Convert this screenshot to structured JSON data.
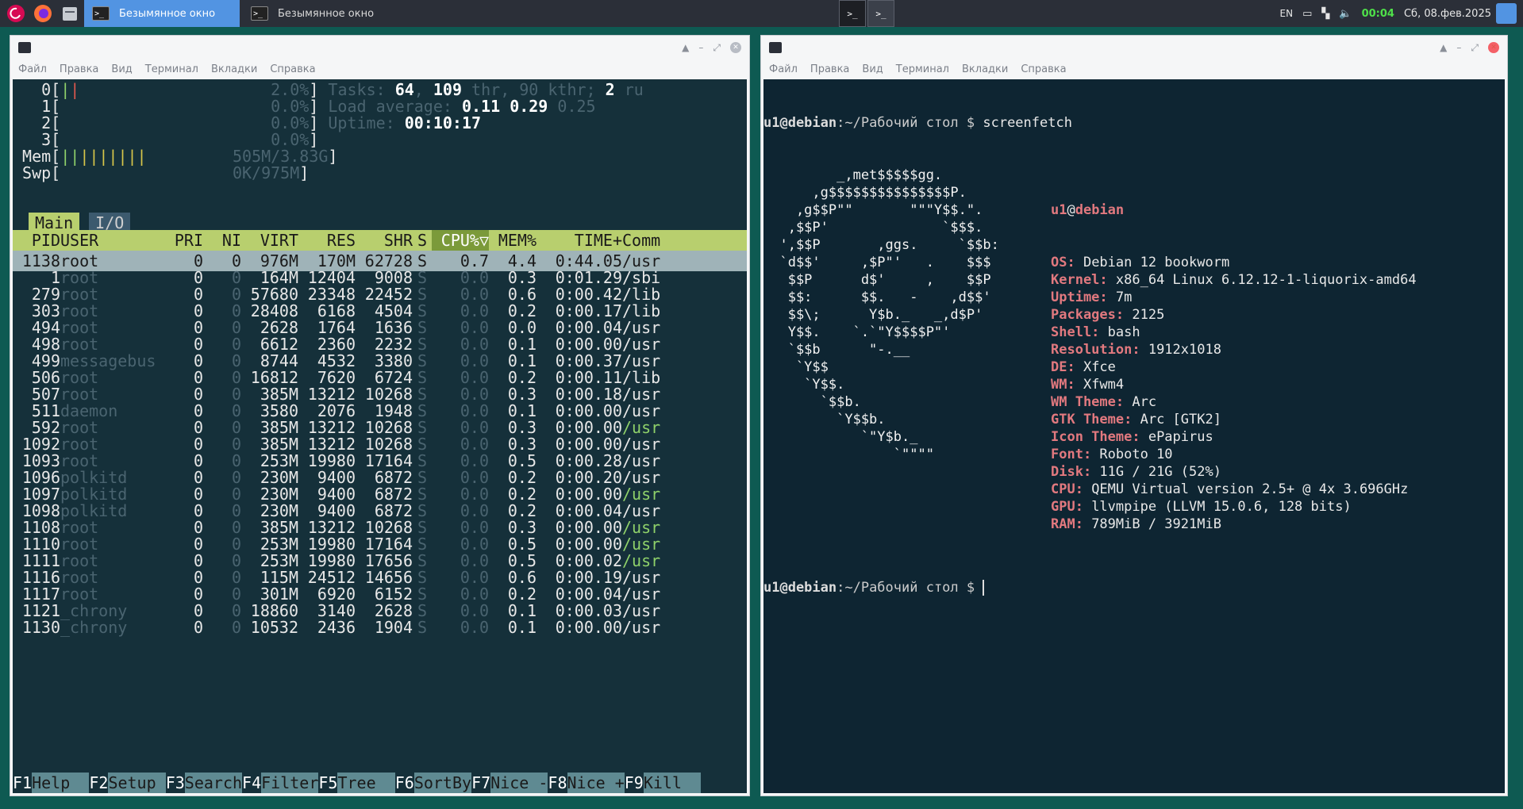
{
  "taskbar": {
    "active_task": "Безымянное окно",
    "inactive_task": "Безымянное окно",
    "lang": "EN",
    "time": "00:04",
    "date": "Сб, 08.фев.2025"
  },
  "left": {
    "menu": [
      "Файл",
      "Правка",
      "Вид",
      "Терминал",
      "Вкладки",
      "Справка"
    ],
    "cpus": [
      {
        "id": "0",
        "pct": "2.0%"
      },
      {
        "id": "1",
        "pct": "0.0%"
      },
      {
        "id": "2",
        "pct": "0.0%"
      },
      {
        "id": "3",
        "pct": "0.0%"
      }
    ],
    "mem": {
      "label": "Mem",
      "value": "505M/3.83G"
    },
    "swp": {
      "label": "Swp",
      "value": "0K/975M"
    },
    "tasks_line": {
      "label": "Tasks: ",
      "a": "64",
      "sep": ", ",
      "b": "109",
      "thr": " thr",
      "c": ", 90 kthr; ",
      "d": "2",
      "ru": " ru"
    },
    "load_line": {
      "label": "Load average: ",
      "a": "0.11",
      "b": "0.29",
      "c": "0.25"
    },
    "uptime_line": {
      "label": "Uptime: ",
      "value": "00:10:17"
    },
    "tabs": {
      "main": "Main",
      "io": "I/O"
    },
    "columns": {
      "pid": "PID",
      "user": "USER",
      "pri": "PRI",
      "ni": "NI",
      "virt": "VIRT",
      "res": "RES",
      "shr": "SHR",
      "s": "S",
      "cpu": "CPU%▽",
      "mem": "MEM%",
      "time": "TIME+",
      "cmd": "Comm"
    },
    "rows": [
      {
        "pid": "1138",
        "user": "root",
        "pri": "0",
        "ni": "0",
        "virt": "976M",
        "res": "170M",
        "shr": "62728",
        "s": "S",
        "cpu": "0.7",
        "mem": "4.4",
        "time": "0:44.05",
        "cmd": "/usr"
      },
      {
        "pid": "1",
        "user": "root",
        "pri": "0",
        "ni": "0",
        "virt": "164M",
        "res": "12404",
        "shr": "9008",
        "s": "S",
        "cpu": "0.0",
        "mem": "0.3",
        "time": "0:01.29",
        "cmd": "/sbi"
      },
      {
        "pid": "279",
        "user": "root",
        "pri": "0",
        "ni": "0",
        "virt": "57680",
        "res": "23348",
        "shr": "22452",
        "s": "S",
        "cpu": "0.0",
        "mem": "0.6",
        "time": "0:00.42",
        "cmd": "/lib"
      },
      {
        "pid": "303",
        "user": "root",
        "pri": "0",
        "ni": "0",
        "virt": "28408",
        "res": "6168",
        "shr": "4504",
        "s": "S",
        "cpu": "0.0",
        "mem": "0.2",
        "time": "0:00.17",
        "cmd": "/lib"
      },
      {
        "pid": "494",
        "user": "root",
        "pri": "0",
        "ni": "0",
        "virt": "2628",
        "res": "1764",
        "shr": "1636",
        "s": "S",
        "cpu": "0.0",
        "mem": "0.0",
        "time": "0:00.04",
        "cmd": "/usr"
      },
      {
        "pid": "498",
        "user": "root",
        "pri": "0",
        "ni": "0",
        "virt": "6612",
        "res": "2360",
        "shr": "2232",
        "s": "S",
        "cpu": "0.0",
        "mem": "0.1",
        "time": "0:00.00",
        "cmd": "/usr"
      },
      {
        "pid": "499",
        "user": "messagebus",
        "pri": "0",
        "ni": "0",
        "virt": "8744",
        "res": "4532",
        "shr": "3380",
        "s": "S",
        "cpu": "0.0",
        "mem": "0.1",
        "time": "0:00.37",
        "cmd": "/usr"
      },
      {
        "pid": "506",
        "user": "root",
        "pri": "0",
        "ni": "0",
        "virt": "16812",
        "res": "7620",
        "shr": "6724",
        "s": "S",
        "cpu": "0.0",
        "mem": "0.2",
        "time": "0:00.11",
        "cmd": "/lib"
      },
      {
        "pid": "507",
        "user": "root",
        "pri": "0",
        "ni": "0",
        "virt": "385M",
        "res": "13212",
        "shr": "10268",
        "s": "S",
        "cpu": "0.0",
        "mem": "0.3",
        "time": "0:00.18",
        "cmd": "/usr"
      },
      {
        "pid": "511",
        "user": "daemon",
        "pri": "0",
        "ni": "0",
        "virt": "3580",
        "res": "2076",
        "shr": "1948",
        "s": "S",
        "cpu": "0.0",
        "mem": "0.1",
        "time": "0:00.00",
        "cmd": "/usr"
      },
      {
        "pid": "592",
        "user": "root",
        "pri": "0",
        "ni": "0",
        "virt": "385M",
        "res": "13212",
        "shr": "10268",
        "s": "S",
        "cpu": "0.0",
        "mem": "0.3",
        "time": "0:00.00",
        "cmd": "/usr"
      },
      {
        "pid": "1092",
        "user": "root",
        "pri": "0",
        "ni": "0",
        "virt": "385M",
        "res": "13212",
        "shr": "10268",
        "s": "S",
        "cpu": "0.0",
        "mem": "0.3",
        "time": "0:00.00",
        "cmd": "/usr"
      },
      {
        "pid": "1093",
        "user": "root",
        "pri": "0",
        "ni": "0",
        "virt": "253M",
        "res": "19980",
        "shr": "17164",
        "s": "S",
        "cpu": "0.0",
        "mem": "0.5",
        "time": "0:00.28",
        "cmd": "/usr"
      },
      {
        "pid": "1096",
        "user": "polkitd",
        "pri": "0",
        "ni": "0",
        "virt": "230M",
        "res": "9400",
        "shr": "6872",
        "s": "S",
        "cpu": "0.0",
        "mem": "0.2",
        "time": "0:00.20",
        "cmd": "/usr"
      },
      {
        "pid": "1097",
        "user": "polkitd",
        "pri": "0",
        "ni": "0",
        "virt": "230M",
        "res": "9400",
        "shr": "6872",
        "s": "S",
        "cpu": "0.0",
        "mem": "0.2",
        "time": "0:00.00",
        "cmd": "/usr"
      },
      {
        "pid": "1098",
        "user": "polkitd",
        "pri": "0",
        "ni": "0",
        "virt": "230M",
        "res": "9400",
        "shr": "6872",
        "s": "S",
        "cpu": "0.0",
        "mem": "0.2",
        "time": "0:00.04",
        "cmd": "/usr"
      },
      {
        "pid": "1108",
        "user": "root",
        "pri": "0",
        "ni": "0",
        "virt": "385M",
        "res": "13212",
        "shr": "10268",
        "s": "S",
        "cpu": "0.0",
        "mem": "0.3",
        "time": "0:00.00",
        "cmd": "/usr"
      },
      {
        "pid": "1110",
        "user": "root",
        "pri": "0",
        "ni": "0",
        "virt": "253M",
        "res": "19980",
        "shr": "17164",
        "s": "S",
        "cpu": "0.0",
        "mem": "0.5",
        "time": "0:00.00",
        "cmd": "/usr"
      },
      {
        "pid": "1111",
        "user": "root",
        "pri": "0",
        "ni": "0",
        "virt": "253M",
        "res": "19980",
        "shr": "17656",
        "s": "S",
        "cpu": "0.0",
        "mem": "0.5",
        "time": "0:00.02",
        "cmd": "/usr"
      },
      {
        "pid": "1116",
        "user": "root",
        "pri": "0",
        "ni": "0",
        "virt": "115M",
        "res": "24512",
        "shr": "14656",
        "s": "S",
        "cpu": "0.0",
        "mem": "0.6",
        "time": "0:00.19",
        "cmd": "/usr"
      },
      {
        "pid": "1117",
        "user": "root",
        "pri": "0",
        "ni": "0",
        "virt": "301M",
        "res": "6920",
        "shr": "6152",
        "s": "S",
        "cpu": "0.0",
        "mem": "0.2",
        "time": "0:00.04",
        "cmd": "/usr"
      },
      {
        "pid": "1121",
        "user": "_chrony",
        "pri": "0",
        "ni": "0",
        "virt": "18860",
        "res": "3140",
        "shr": "2628",
        "s": "S",
        "cpu": "0.0",
        "mem": "0.1",
        "time": "0:00.03",
        "cmd": "/usr"
      },
      {
        "pid": "1130",
        "user": "_chrony",
        "pri": "0",
        "ni": "0",
        "virt": "10532",
        "res": "2436",
        "shr": "1904",
        "s": "S",
        "cpu": "0.0",
        "mem": "0.1",
        "time": "0:00.00",
        "cmd": "/usr"
      }
    ],
    "fkeys": [
      {
        "k": "F1",
        "l": "Help  "
      },
      {
        "k": "F2",
        "l": "Setup "
      },
      {
        "k": "F3",
        "l": "Search"
      },
      {
        "k": "F4",
        "l": "Filter"
      },
      {
        "k": "F5",
        "l": "Tree  "
      },
      {
        "k": "F6",
        "l": "SortBy"
      },
      {
        "k": "F7",
        "l": "Nice -"
      },
      {
        "k": "F8",
        "l": "Nice +"
      },
      {
        "k": "F9",
        "l": "Kill  "
      }
    ]
  },
  "right": {
    "menu": [
      "Файл",
      "Правка",
      "Вид",
      "Терминал",
      "Вкладки",
      "Справка"
    ],
    "prompt_user": "u1@debian",
    "prompt_path": ":~/Рабочий стол $ ",
    "command": "screenfetch",
    "art": [
      "         _,met$$$$$gg.",
      "      ,g$$$$$$$$$$$$$$$P.",
      "    ,g$$P\"\"       \"\"\"Y$$.\".",
      "   ,$$P'              `$$$.",
      "  ',$$P       ,ggs.     `$$b:",
      "  `d$$'     ,$P\"'   .    $$$",
      "   $$P      d$'     ,    $$P",
      "   $$:      $$.   -    ,d$$'",
      "   $$\\;      Y$b._   _,d$P'",
      "   Y$$.    `.`\"Y$$$$P\"'",
      "   `$$b      \"-.__",
      "    `Y$$",
      "     `Y$$.",
      "       `$$b.",
      "         `Y$$b.",
      "            `\"Y$b._",
      "                `\"\"\"\""
    ],
    "header_user": "u1",
    "header_at": "@",
    "header_host": "debian",
    "info": [
      {
        "k": "OS:",
        "v": " Debian 12 bookworm"
      },
      {
        "k": "Kernel:",
        "v": " x86_64 Linux 6.12.12-1-liquorix-amd64"
      },
      {
        "k": "Uptime:",
        "v": " 7m"
      },
      {
        "k": "Packages:",
        "v": " 2125"
      },
      {
        "k": "Shell:",
        "v": " bash"
      },
      {
        "k": "Resolution:",
        "v": " 1912x1018"
      },
      {
        "k": "DE:",
        "v": " Xfce"
      },
      {
        "k": "WM:",
        "v": " Xfwm4"
      },
      {
        "k": "WM Theme:",
        "v": " Arc"
      },
      {
        "k": "GTK Theme:",
        "v": " Arc [GTK2]"
      },
      {
        "k": "Icon Theme:",
        "v": " ePapirus"
      },
      {
        "k": "Font:",
        "v": " Roboto 10"
      },
      {
        "k": "Disk:",
        "v": " 11G / 21G (52%)"
      },
      {
        "k": "CPU:",
        "v": " QEMU Virtual version 2.5+ @ 4x 3.696GHz"
      },
      {
        "k": "GPU:",
        "v": " llvmpipe (LLVM 15.0.6, 128 bits)"
      },
      {
        "k": "RAM:",
        "v": " 789MiB / 3921MiB"
      }
    ]
  }
}
